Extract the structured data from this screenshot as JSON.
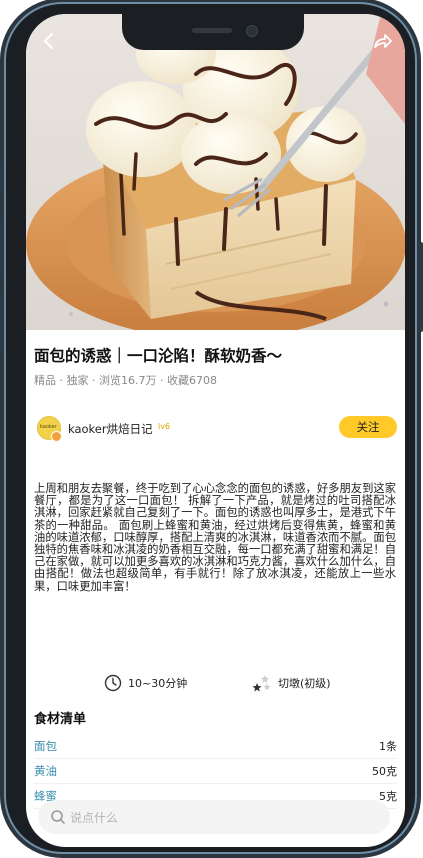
{
  "recipe": {
    "title": "面包的诱惑｜一口沦陷！酥软奶香～",
    "meta": "精品 · 独家 · 浏览16.7万 · 收藏6708",
    "description": "上周和朋友去聚餐，终于吃到了心心念念的面包的诱惑，好多朋友到这家餐厅，都是为了这一口面包！ 拆解了一下产品，就是烤过的吐司搭配冰淇淋，回家赶紧就自己复刻了一下。面包的诱惑也叫厚多士，是港式下午茶的一种甜品。 面包刷上蜂蜜和黄油，经过烘烤后变得焦黄，蜂蜜和黄油的味道浓郁，口味醇厚，搭配上清爽的冰淇淋，味道香浓而不腻。面包独特的焦香味和冰淇凌的奶香相互交融，每一口都充满了甜蜜和满足！自己在家做，就可以加更多喜欢的冰淇淋和巧克力酱，喜欢什么加什么，自由搭配！做法也超级简单，有手就行！除了放冰淇凌，还能放上一些水果，口味更加丰富！",
    "time": "10~30分钟",
    "difficulty": "切墩(初级)"
  },
  "author": {
    "name": "kaoker烘焙日记",
    "level": "lv6",
    "follow_label": "关注",
    "avatar_text": "kaoker"
  },
  "ingredients": {
    "title": "食材清单",
    "items": [
      {
        "name": "面包",
        "amount": "1条"
      },
      {
        "name": "黄油",
        "amount": "50克"
      },
      {
        "name": "蜂蜜",
        "amount": "5克"
      }
    ]
  },
  "comment": {
    "placeholder": "说点什么"
  },
  "colors": {
    "accent": "#ffc928",
    "ingredient_link": "#3a8fb0"
  },
  "icons": {
    "back": "back-arrow-icon",
    "share": "share-icon",
    "clock": "clock-icon",
    "difficulty": "stars-icon",
    "search": "search-icon"
  }
}
